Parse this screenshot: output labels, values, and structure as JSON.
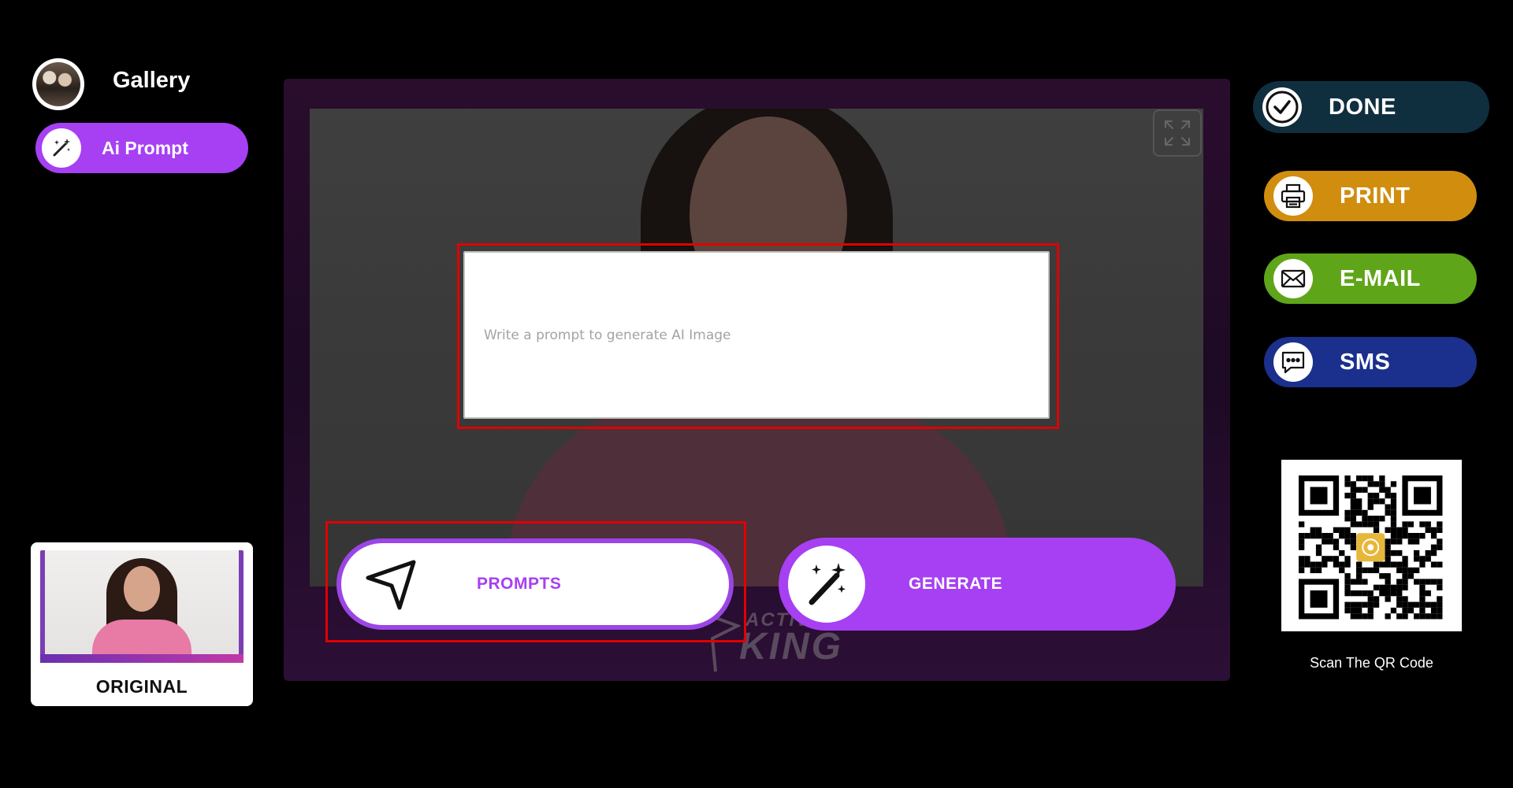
{
  "sidebar": {
    "gallery_label": "Gallery",
    "ai_prompt_label": "Ai Prompt",
    "original_label": "ORIGINAL"
  },
  "editor": {
    "prompt_placeholder": "Write a prompt to generate AI Image",
    "prompt_value": "",
    "prompts_label": "PROMPTS",
    "generate_label": "GENERATE",
    "watermark_line1": "ACTIV",
    "watermark_line2": "KING"
  },
  "actions": {
    "done_label": "DONE",
    "print_label": "PRINT",
    "email_label": "E-MAIL",
    "sms_label": "SMS"
  },
  "qr": {
    "caption": "Scan The QR Code"
  },
  "colors": {
    "accent": "#a640f2",
    "done": "#0f2f3f",
    "print": "#d08d0e",
    "email": "#5fa51a",
    "sms": "#1b2f8c",
    "highlight": "#e00000"
  }
}
